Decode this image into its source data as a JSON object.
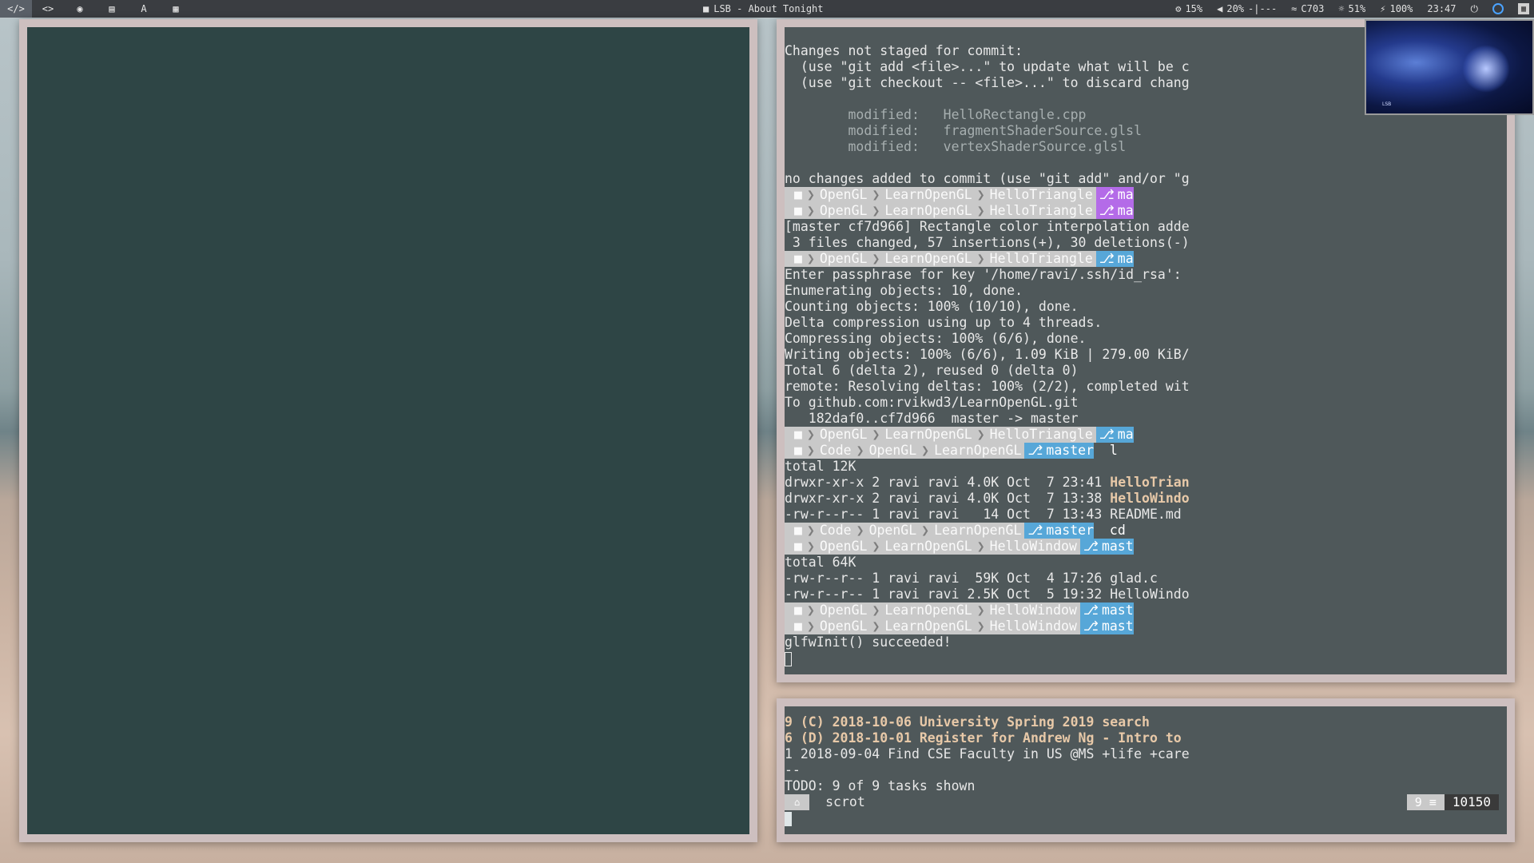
{
  "topbar": {
    "workspaces": [
      {
        "icon": "code-icon",
        "glyph": "</>"
      },
      {
        "icon": "brackets-icon",
        "glyph": "<>"
      },
      {
        "icon": "chrome-icon",
        "glyph": "◉"
      },
      {
        "icon": "file-icon",
        "glyph": "▤"
      },
      {
        "icon": "font-icon",
        "glyph": "A"
      },
      {
        "icon": "film-icon",
        "glyph": "▦"
      }
    ],
    "window_title": "LSB - About Tonight",
    "cpu": "15%",
    "volume": "20%",
    "volume_bar": "-|---",
    "wifi": "C703",
    "brightness": "51%",
    "battery": "100%",
    "clock": "23:47"
  },
  "terminal": {
    "lines": [
      {
        "kind": "text",
        "text": "Changes not staged for commit:"
      },
      {
        "kind": "text",
        "text": "  (use \"git add <file>...\" to update what will be c"
      },
      {
        "kind": "text",
        "text": "  (use \"git checkout -- <file>...\" to discard chang"
      },
      {
        "kind": "blank",
        "text": ""
      },
      {
        "kind": "dim",
        "text": "        modified:   HelloRectangle.cpp"
      },
      {
        "kind": "dim",
        "text": "        modified:   fragmentShaderSource.glsl"
      },
      {
        "kind": "dim",
        "text": "        modified:   vertexShaderSource.glsl"
      },
      {
        "kind": "blank",
        "text": ""
      },
      {
        "kind": "text",
        "text": "no changes added to commit (use \"git add\" and/or \"g"
      },
      {
        "kind": "prompt",
        "dirs": [
          "OpenGL",
          "LearnOpenGL",
          "HelloTriangle"
        ],
        "git": "ma",
        "color": "purple"
      },
      {
        "kind": "prompt",
        "dirs": [
          "OpenGL",
          "LearnOpenGL",
          "HelloTriangle"
        ],
        "git": "ma",
        "color": "purple"
      },
      {
        "kind": "text",
        "text": "[master cf7d966] Rectangle color interpolation adde"
      },
      {
        "kind": "text",
        "text": " 3 files changed, 57 insertions(+), 30 deletions(-)"
      },
      {
        "kind": "prompt",
        "dirs": [
          "OpenGL",
          "LearnOpenGL",
          "HelloTriangle"
        ],
        "git": "ma",
        "color": "blue"
      },
      {
        "kind": "text",
        "text": "Enter passphrase for key '/home/ravi/.ssh/id_rsa':"
      },
      {
        "kind": "text",
        "text": "Enumerating objects: 10, done."
      },
      {
        "kind": "text",
        "text": "Counting objects: 100% (10/10), done."
      },
      {
        "kind": "text",
        "text": "Delta compression using up to 4 threads."
      },
      {
        "kind": "text",
        "text": "Compressing objects: 100% (6/6), done."
      },
      {
        "kind": "text",
        "text": "Writing objects: 100% (6/6), 1.09 KiB | 279.00 KiB/"
      },
      {
        "kind": "text",
        "text": "Total 6 (delta 2), reused 0 (delta 0)"
      },
      {
        "kind": "text",
        "text": "remote: Resolving deltas: 100% (2/2), completed wit"
      },
      {
        "kind": "text",
        "text": "To github.com:rvikwd3/LearnOpenGL.git"
      },
      {
        "kind": "text",
        "text": "   182daf0..cf7d966  master -> master"
      },
      {
        "kind": "prompt",
        "dirs": [
          "OpenGL",
          "LearnOpenGL",
          "HelloTriangle"
        ],
        "git": "ma",
        "color": "blue"
      },
      {
        "kind": "prompt",
        "dirs": [
          "Code",
          "OpenGL",
          "LearnOpenGL"
        ],
        "git": "master",
        "color": "blue",
        "cmd": "l"
      },
      {
        "kind": "text",
        "text": "total 12K"
      },
      {
        "kind": "ls",
        "text": "drwxr-xr-x 2 ravi ravi 4.0K Oct  7 23:41 ",
        "name": "HelloTrian"
      },
      {
        "kind": "ls",
        "text": "drwxr-xr-x 2 ravi ravi 4.0K Oct  7 13:38 ",
        "name": "HelloWindo"
      },
      {
        "kind": "text",
        "text": "-rw-r--r-- 1 ravi ravi   14 Oct  7 13:43 README.md"
      },
      {
        "kind": "prompt",
        "dirs": [
          "Code",
          "OpenGL",
          "LearnOpenGL"
        ],
        "git": "master",
        "color": "blue",
        "cmd": "cd"
      },
      {
        "kind": "prompt",
        "dirs": [
          "OpenGL",
          "LearnOpenGL",
          "HelloWindow"
        ],
        "git": "mast",
        "color": "blue"
      },
      {
        "kind": "text",
        "text": "total 64K"
      },
      {
        "kind": "text",
        "text": "-rw-r--r-- 1 ravi ravi  59K Oct  4 17:26 glad.c"
      },
      {
        "kind": "text",
        "text": "-rw-r--r-- 1 ravi ravi 2.5K Oct  5 19:32 HelloWindo"
      },
      {
        "kind": "prompt",
        "dirs": [
          "OpenGL",
          "LearnOpenGL",
          "HelloWindow"
        ],
        "git": "mast",
        "color": "blue"
      },
      {
        "kind": "prompt",
        "dirs": [
          "OpenGL",
          "LearnOpenGL",
          "HelloWindow"
        ],
        "git": "mast",
        "color": "blue"
      },
      {
        "kind": "text",
        "text": "glfwInit() succeeded!"
      },
      {
        "kind": "cursor",
        "text": ""
      }
    ]
  },
  "todo": {
    "lines": [
      {
        "bold": true,
        "text": "9 (C) 2018-10-06 University Spring 2019 search"
      },
      {
        "bold": true,
        "text": "6 (D) 2018-10-01 Register for Andrew Ng - Intro to"
      },
      {
        "bold": false,
        "text": "1 2018-09-04 Find CSE Faculty in US @MS +life +care"
      },
      {
        "bold": false,
        "text": "--"
      },
      {
        "bold": false,
        "text": "TODO: 9 of 9 tasks shown"
      }
    ],
    "prompt_cmd": "scrot",
    "right_count": "9 ≡",
    "right_number": "10150"
  }
}
